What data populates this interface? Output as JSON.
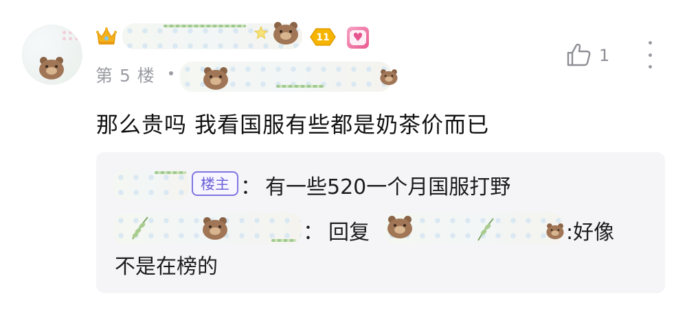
{
  "comment": {
    "floor_label": "第 5 楼",
    "text": "那么贵吗 我看国服有些都是奶茶价而已",
    "like_count": "1"
  },
  "user": {
    "level_badge": "11"
  },
  "replies": {
    "first": {
      "op_tag": "楼主",
      "colon": "：",
      "text": "有一些520一个月国服打野"
    },
    "second": {
      "colon": "：",
      "reply_prefix": "回复",
      "suffix": ":好像",
      "text_line2": "不是在榜的"
    }
  },
  "colors": {
    "op_tag_border": "#7e74e0",
    "level_badge": "#f2a900",
    "heart_badge": "#e8588f",
    "reply_background": "#f5f5f7"
  },
  "icons": [
    "crown-icon",
    "level-badge-icon",
    "heart-badge-icon",
    "like-icon",
    "more-icon",
    "bear-avatar-icon"
  ]
}
